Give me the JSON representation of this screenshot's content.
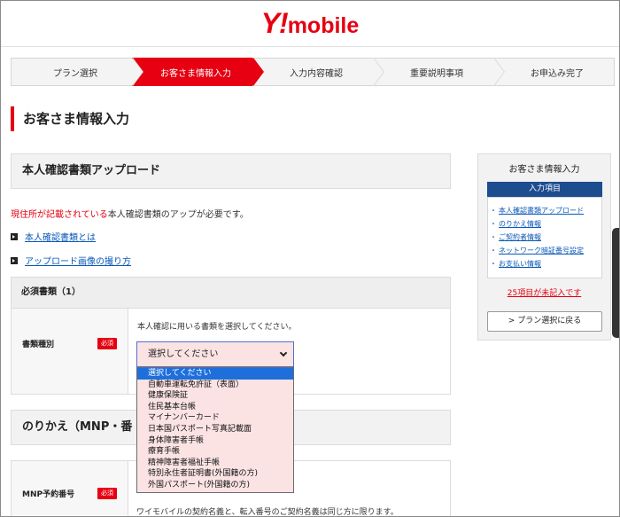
{
  "brand": {
    "logo_y": "Y!",
    "logo_mobile": "mobile",
    "accent": "#e60012"
  },
  "steps": [
    {
      "label": "プラン選択",
      "active": false
    },
    {
      "label": "お客さま情報入力",
      "active": true
    },
    {
      "label": "入力内容確認",
      "active": false
    },
    {
      "label": "重要説明事項",
      "active": false
    },
    {
      "label": "お申込み完了",
      "active": false
    }
  ],
  "page_title": "お客さま情報入力",
  "upload_section": {
    "title": "本人確認書類アップロード",
    "notice_red": "現住所が記載されている",
    "notice_rest": "本人確認書類のアップが必要です。",
    "link1": "本人確認書類とは",
    "link2": "アップロード画像の撮り方",
    "required_header": "必須書類（1）",
    "doc_type_label": "書類種別",
    "required_badge": "必須",
    "help": "本人確認に用いる書類を選択してください。",
    "select_value": "選択してください",
    "options": [
      "選択してください",
      "自動車運転免許証（表面）",
      "健康保険証",
      "住民基本台帳",
      "マイナンバーカード",
      "日本国パスポート写真記載面",
      "身体障害者手帳",
      "療育手帳",
      "精神障害者福祉手帳",
      "特別永住者証明書(外国籍の方)",
      "外国パスポート(外国籍の方)"
    ]
  },
  "mnp_section": {
    "title": "のりかえ（MNP・番",
    "label": "MNP予約番号",
    "required_badge": "必須",
    "note": "ワイモバイルの契約名義と、転入番号のご契約名義は同じ方に限ります。"
  },
  "side_panel": {
    "title": "お客さま情報入力",
    "subtitle": "入力項目",
    "items": [
      "本人確認書類アップロード",
      "のりかえ情報",
      "ご契約者情報",
      "ネットワーク暗証番号設定",
      "お支払い情報"
    ],
    "warning": "25項目が未記入です",
    "back_button": "> プラン選択に戻る"
  }
}
